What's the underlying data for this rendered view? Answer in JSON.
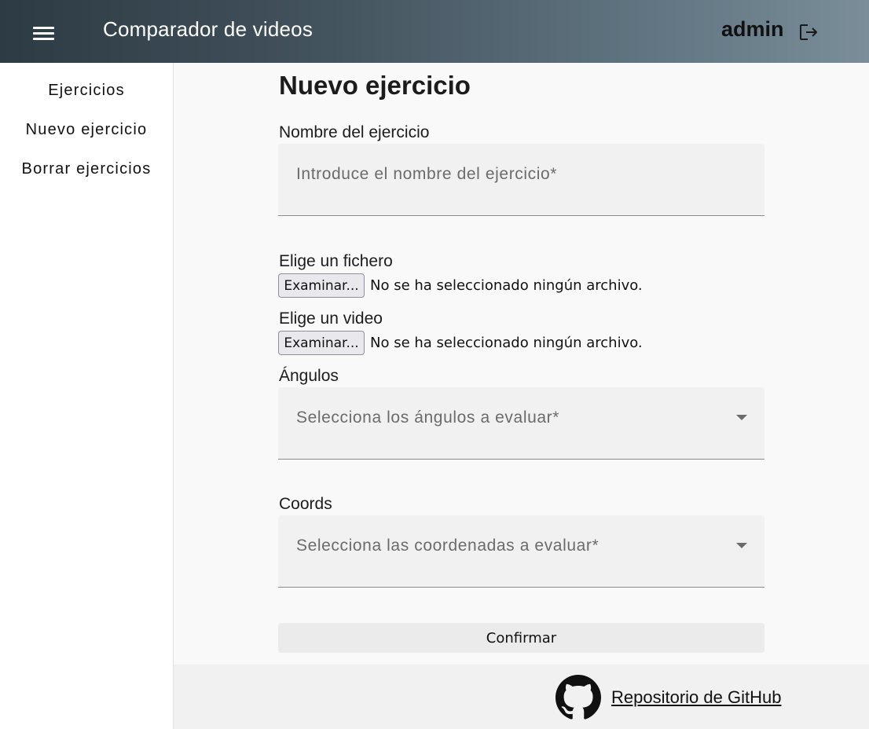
{
  "header": {
    "title": "Comparador de videos",
    "user": "admin",
    "menu_icon": "hamburger-menu-icon",
    "logout_icon": "logout-icon"
  },
  "sidebar": {
    "items": [
      {
        "label": "Ejercicios"
      },
      {
        "label": "Nuevo ejercicio"
      },
      {
        "label": "Borrar ejercicios"
      }
    ]
  },
  "form": {
    "title": "Nuevo ejercicio",
    "name": {
      "label": "Nombre del ejercicio",
      "placeholder": "Introduce el nombre del ejercicio*",
      "value": ""
    },
    "file": {
      "label": "Elige un fichero",
      "button": "Examinar...",
      "status": "No se ha seleccionado ningún archivo."
    },
    "video": {
      "label": "Elige un video",
      "button": "Examinar...",
      "status": "No se ha seleccionado ningún archivo."
    },
    "angles": {
      "label": "Ángulos",
      "placeholder": "Selecciona los ángulos a evaluar*"
    },
    "coords": {
      "label": "Coords",
      "placeholder": "Selecciona las coordenadas a evaluar*"
    },
    "confirm": "Confirmar"
  },
  "footer": {
    "link": "Repositorio de GitHub",
    "icon": "github-icon"
  }
}
